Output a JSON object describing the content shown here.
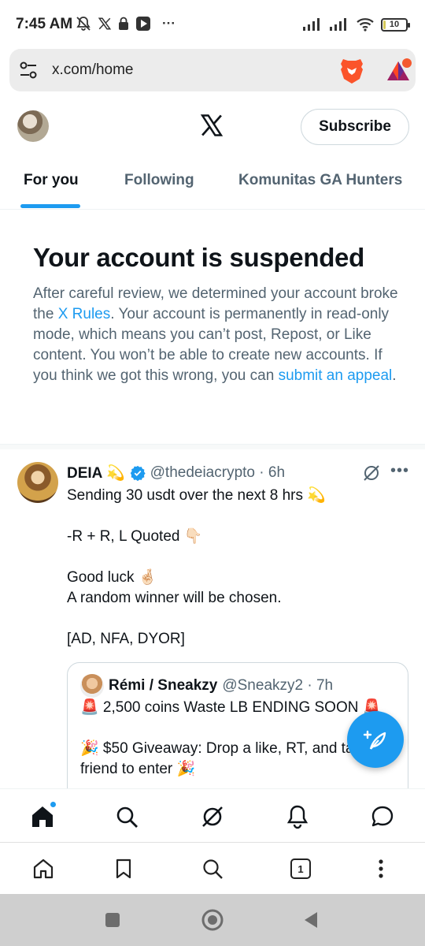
{
  "status_bar": {
    "time": "7:45 AM",
    "notification_icons": [
      "mute-bell-icon",
      "x-icon",
      "lock-icon",
      "media-icon"
    ],
    "more": "···",
    "battery": "10",
    "battery_level_percent": 10
  },
  "browser": {
    "url": "x.com/home",
    "tab_count": "1"
  },
  "header": {
    "subscribe_label": "Subscribe"
  },
  "tabs": [
    {
      "label": "For you",
      "active": true
    },
    {
      "label": "Following",
      "active": false
    },
    {
      "label": "Komunitas GA Hunters",
      "active": false
    }
  ],
  "notice": {
    "title": "Your account is suspended",
    "text_1": "After careful review, we determined your account broke the ",
    "link_1": "X Rules",
    "text_2": ". Your account is permanently in read-only mode, which means you can’t post, Repost, or Like content. You won’t be able to create new accounts. If you think we got this wrong, you can ",
    "link_2": "submit an appeal",
    "text_3": "."
  },
  "tweet": {
    "name": "DEIA 💫",
    "handle": "@thedeiacrypto · 6h",
    "lines": [
      "Sending 30 usdt over the next 8 hrs 💫",
      "",
      "-R + R, L Quoted 👇🏻",
      "",
      "Good luck 🤞🏻",
      "A random winner will be chosen.",
      "",
      "[AD, NFA, DYOR]"
    ],
    "quote": {
      "name": "Rémi / Sneakzy",
      "handle": "@Sneakzy2 · 7h",
      "lines": [
        "🚨 2,500 coins Waste LB ENDING SOON 🚨",
        "",
        "🎉 $50 Giveaway: Drop a like, RT, and tag a",
        "friend to enter 🎉"
      ]
    }
  },
  "colors": {
    "accent": "#1d9bf0",
    "text_primary": "#0f1419",
    "text_secondary": "#536471"
  }
}
